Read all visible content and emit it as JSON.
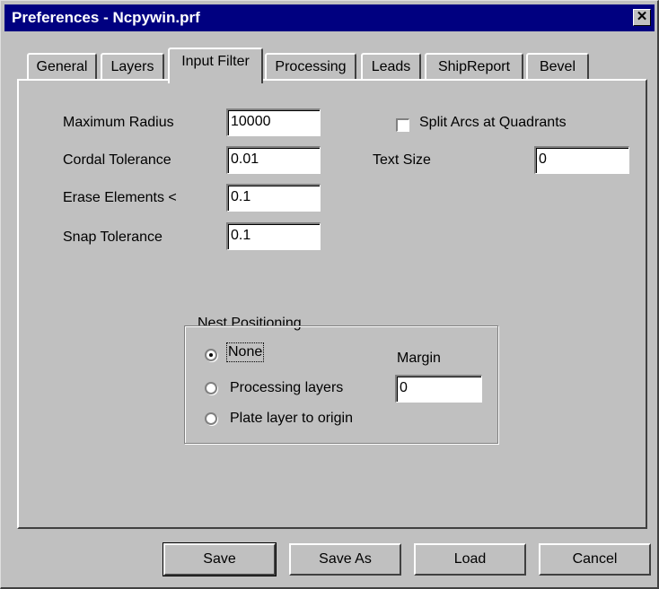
{
  "window": {
    "title": "Preferences - Ncpywin.prf",
    "close_glyph": "✕"
  },
  "tabs": [
    {
      "label": "General"
    },
    {
      "label": "Layers"
    },
    {
      "label": "Input Filter",
      "active": true
    },
    {
      "label": "Processing"
    },
    {
      "label": "Leads"
    },
    {
      "label": "ShipReport"
    },
    {
      "label": "Bevel"
    }
  ],
  "form": {
    "max_radius": {
      "label": "Maximum Radius",
      "value": "10000"
    },
    "cordal_tolerance": {
      "label": "Cordal Tolerance",
      "value": "0.01"
    },
    "erase_elements": {
      "label": "Erase Elements <",
      "value": "0.1"
    },
    "snap_tolerance": {
      "label": "Snap Tolerance",
      "value": "0.1"
    },
    "split_arcs": {
      "label": "Split Arcs at Quadrants",
      "checked": false
    },
    "text_size": {
      "label": "Text Size",
      "value": "0"
    }
  },
  "nest_positioning": {
    "legend": "Nest Positioning",
    "options": [
      {
        "label": "None",
        "selected": true
      },
      {
        "label": "Processing layers",
        "selected": false
      },
      {
        "label": "Plate layer to origin",
        "selected": false
      }
    ],
    "margin": {
      "label": "Margin",
      "value": "0"
    }
  },
  "buttons": {
    "save": "Save",
    "save_as": "Save As",
    "load": "Load",
    "cancel": "Cancel"
  },
  "colors": {
    "titlebar": "#000080",
    "face": "#c0c0c0"
  }
}
